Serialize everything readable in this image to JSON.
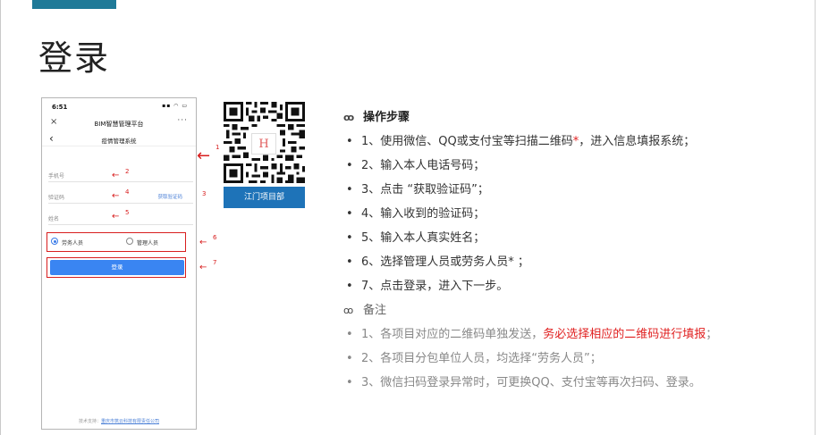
{
  "slide": {
    "title": "登录",
    "accent_color": "#1f7a98"
  },
  "phone": {
    "status_time": "6:51",
    "status_icons": "▪▪ ◠ ▭",
    "nav_title": "BIM智慧管理平台",
    "nav_close": "×",
    "nav_more": "···",
    "page_title": "疫情管理系统",
    "back": "‹",
    "fields": {
      "phone_label": "手机号",
      "code_label": "验证码",
      "get_code": "获取验证码",
      "name_label": "姓名"
    },
    "radio": {
      "labor": "劳务人员",
      "manager": "管理人员",
      "selected": "labor"
    },
    "login_button": "登录",
    "footer_prefix": "技术支持：",
    "footer_company": "重庆市筑云科技有限责任公司",
    "button_color": "#3a85f2"
  },
  "annotations": {
    "n1": "1",
    "n2": "2",
    "n3": "3",
    "n4": "4",
    "n5": "5",
    "n6": "6",
    "n7": "7",
    "arrow": "←",
    "color": "#d81e1e"
  },
  "qr": {
    "caption": "江门项目部",
    "logo": "H",
    "caption_color": "#1e73b8"
  },
  "instructions": {
    "steps_heading": "操作步骤",
    "steps": [
      {
        "pre": "1、使用微信、QQ或支付宝等扫描二维码",
        "red": "*",
        "post": "，进入信息填报系统；"
      },
      {
        "pre": "2、输入本人电话号码；"
      },
      {
        "pre": "3、点击 “获取验证码”；"
      },
      {
        "pre": "4、输入收到的验证码；"
      },
      {
        "pre": "5、输入本人真实姓名；"
      },
      {
        "pre": "6、选择管理人员或劳务人员* ；"
      },
      {
        "pre": "7、点击登录，进入下一步。"
      }
    ],
    "notes_heading": "备注",
    "notes": [
      {
        "pre": "1、各项目对应的二维码单独发送，",
        "red": "务必选择相应的二维码进行填报",
        "post": "；"
      },
      {
        "pre": "2、各项目分包单位人员，均选择“劳务人员”；"
      },
      {
        "pre": "3、微信扫码登录异常时，可更换QQ、支付宝等再次扫码、登录。"
      }
    ],
    "bullet": "•",
    "heading_icon": "ꝏ"
  }
}
